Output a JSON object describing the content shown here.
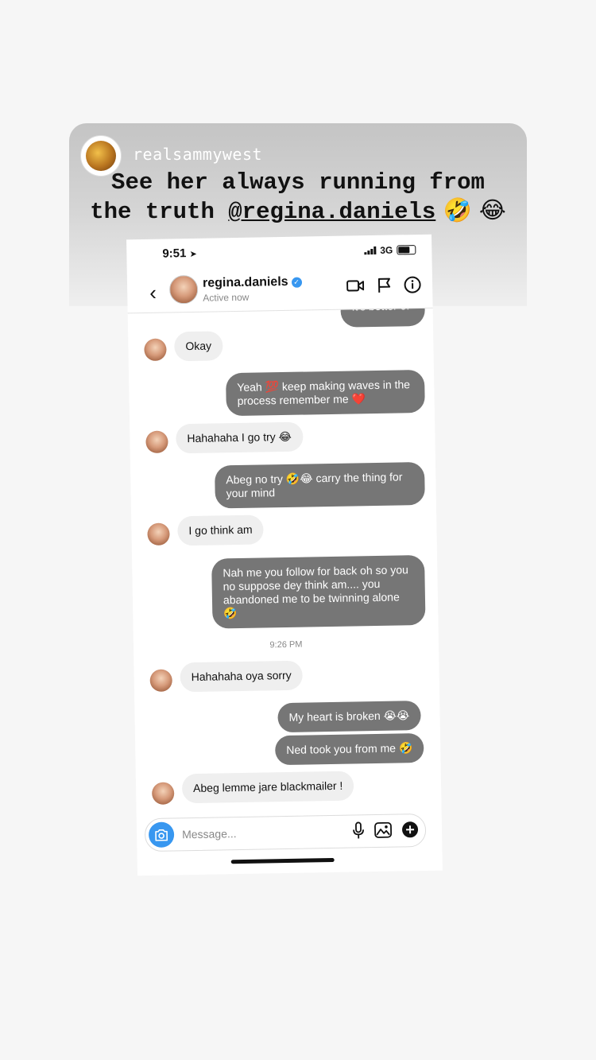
{
  "story": {
    "username": "realsammywest",
    "caption_prefix": "See her always running from the truth ",
    "caption_mention": "@regina.daniels",
    "caption_emoji": " 🤣 😂"
  },
  "status": {
    "time": "9:51",
    "network": "3G"
  },
  "dm": {
    "name": "regina.daniels",
    "status": "Active now",
    "composer_placeholder": "Message..."
  },
  "messages": [
    {
      "side": "out",
      "text": "It's better of"
    },
    {
      "side": "in",
      "text": "Okay"
    },
    {
      "side": "out",
      "text": "Yeah 💯 keep making waves in the process remember me ❤️"
    },
    {
      "side": "in",
      "text": "Hahahaha I go try 😂"
    },
    {
      "side": "out",
      "text": "Abeg no try 🤣😂 carry the thing for your mind"
    },
    {
      "side": "in",
      "text": "I go think am"
    },
    {
      "side": "out",
      "text": "Nah me you follow for back oh so you no suppose dey think am.... you abandoned me to be twinning alone 🤣"
    },
    {
      "side": "in",
      "text": "Hahahaha oya sorry"
    },
    {
      "side": "out",
      "text": "My heart is broken 😭😭"
    },
    {
      "side": "out",
      "text": "Ned took you from me 🤣"
    },
    {
      "side": "in",
      "text": "Abeg lemme jare blackmailer !"
    }
  ],
  "time_separator": "9:26 PM"
}
